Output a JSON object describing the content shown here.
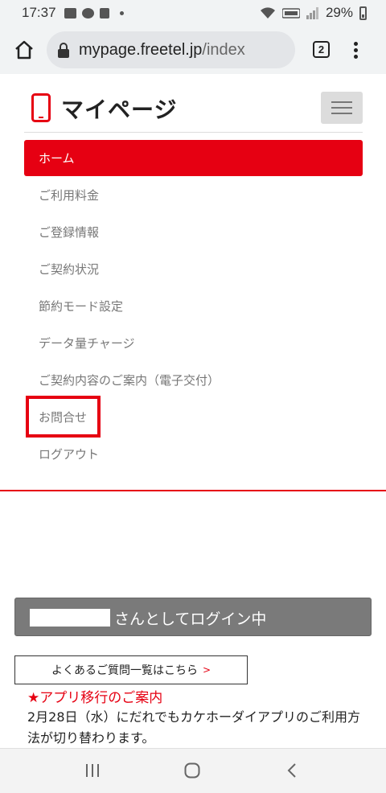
{
  "status_bar": {
    "time": "17:37",
    "battery": "29%",
    "icons": [
      "gallery-icon",
      "line-icon",
      "notification-icon",
      "wifi-icon",
      "volte-icon",
      "signal-icon",
      "battery-icon"
    ]
  },
  "browser": {
    "url_host": "mypage.freetel.jp",
    "url_path": "/index",
    "tab_count": "2"
  },
  "header": {
    "title": "マイページ",
    "accent_color": "#e60012"
  },
  "nav": {
    "items": [
      {
        "label": "ホーム",
        "active": true
      },
      {
        "label": "ご利用料金"
      },
      {
        "label": "ご登録情報"
      },
      {
        "label": "ご契約状況"
      },
      {
        "label": "節約モード設定"
      },
      {
        "label": "データ量チャージ"
      },
      {
        "label": "ご契約内容のご案内（電子交付）"
      },
      {
        "label": "お問合せ",
        "highlighted": true
      },
      {
        "label": "ログアウト"
      }
    ]
  },
  "login": {
    "status": "さんとしてログイン中"
  },
  "faq": {
    "label": "よくあるご質問一覧はこちら",
    "arrow": ">"
  },
  "notice": {
    "title": "★アプリ移行のご案内",
    "body": "2月28日（水）にだれでもカケホーダイアプリのご利用方法が切り替わります。"
  }
}
